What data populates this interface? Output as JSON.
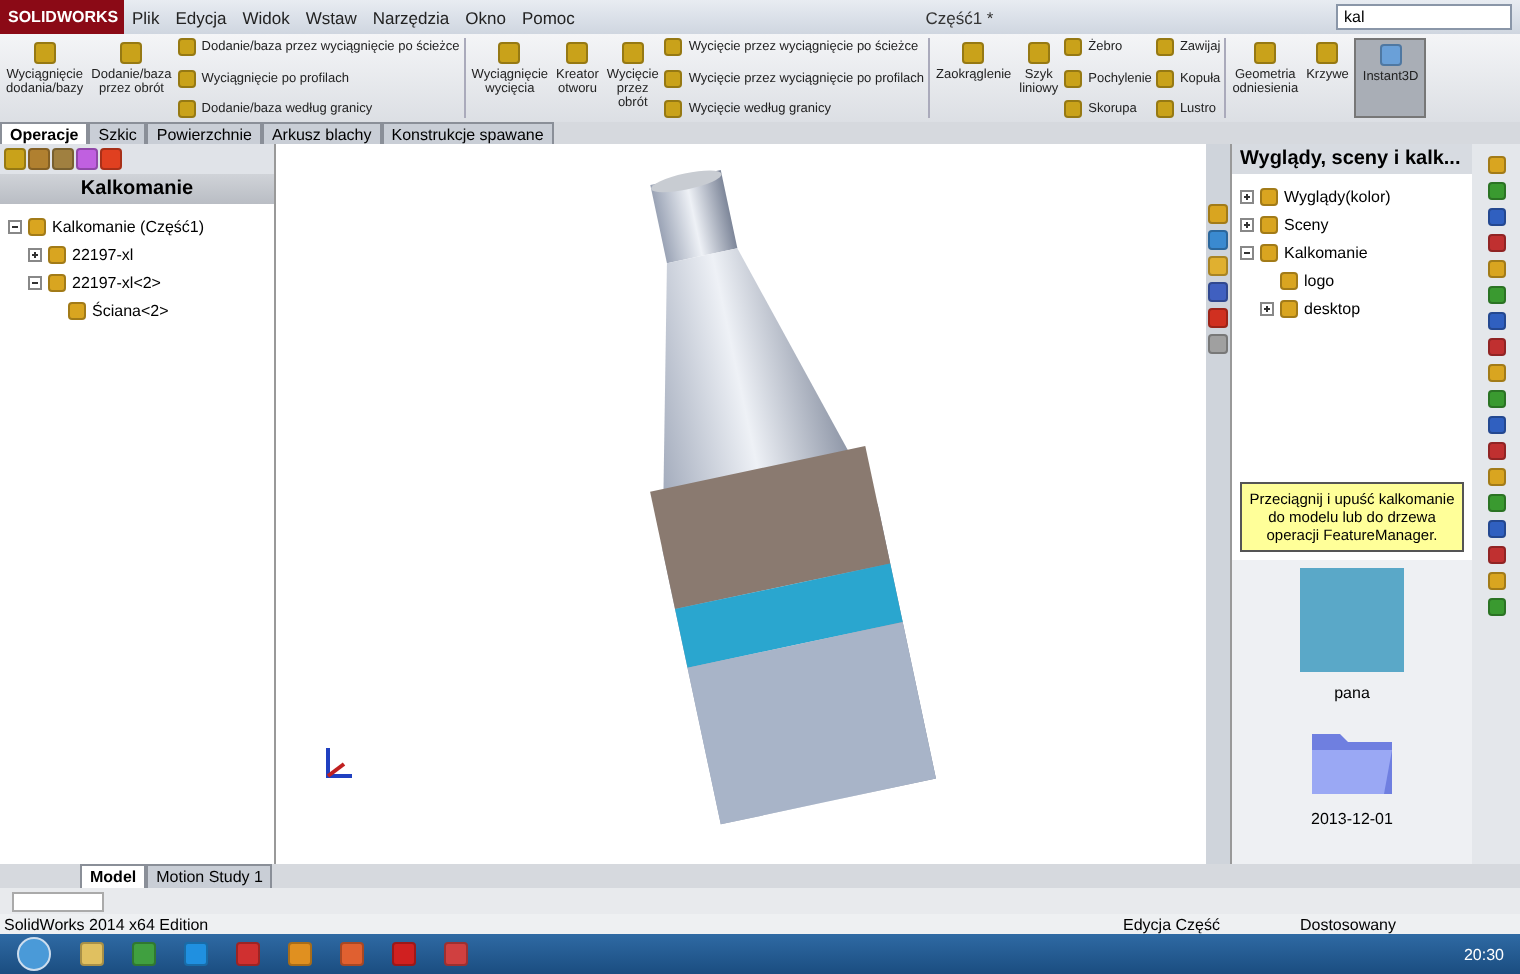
{
  "logo": "SOLIDWORKS",
  "menu": [
    "Plik",
    "Edycja",
    "Widok",
    "Wstaw",
    "Narzędzia",
    "Okno",
    "Pomoc"
  ],
  "title": "Część1 *",
  "search": {
    "value": "kal"
  },
  "ribbon": [
    {
      "kind": "large",
      "label": "Wyciągnięcie dodania/bazy"
    },
    {
      "kind": "large",
      "label": "Dodanie/baza przez obrót"
    },
    {
      "kind": "small",
      "items": [
        "Dodanie/baza przez wyciągnięcie po ścieżce",
        "Wyciągnięcie po profilach",
        "Dodanie/baza według granicy"
      ]
    },
    {
      "kind": "divider"
    },
    {
      "kind": "large",
      "label": "Wyciągnięcie wycięcia"
    },
    {
      "kind": "large",
      "label": "Kreator otworu"
    },
    {
      "kind": "large",
      "label": "Wycięcie przez obrót"
    },
    {
      "kind": "small",
      "items": [
        "Wycięcie przez wyciągnięcie po ścieżce",
        "Wycięcie przez wyciągnięcie po profilach",
        "Wycięcie według granicy"
      ]
    },
    {
      "kind": "divider"
    },
    {
      "kind": "large",
      "label": "Zaokrąglenie"
    },
    {
      "kind": "large",
      "label": "Szyk liniowy"
    },
    {
      "kind": "small",
      "items": [
        "Żebro",
        "Pochylenie",
        "Skorupa"
      ]
    },
    {
      "kind": "small",
      "items": [
        "Zawijaj",
        "Kopuła",
        "Lustro"
      ]
    },
    {
      "kind": "divider"
    },
    {
      "kind": "large",
      "label": "Geometria odniesienia"
    },
    {
      "kind": "large",
      "label": "Krzywe"
    },
    {
      "kind": "toggle",
      "label": "Instant3D",
      "on": true
    }
  ],
  "command_tabs": [
    {
      "label": "Operacje",
      "selected": true
    },
    {
      "label": "Szkic",
      "selected": false
    },
    {
      "label": "Powierzchnie",
      "selected": false
    },
    {
      "label": "Arkusz blachy",
      "selected": false
    },
    {
      "label": "Konstrukcje spawane",
      "selected": false
    }
  ],
  "left_panel": {
    "title": "Kalkomanie",
    "tree": [
      {
        "label": "Kalkomanie (Część1)",
        "expanded": true,
        "children": [
          {
            "label": "22197-xl",
            "expanded": false
          },
          {
            "label": "22197-xl<2>",
            "expanded": true,
            "children": [
              {
                "label": "Ściana<2>"
              }
            ]
          }
        ]
      }
    ]
  },
  "task_pane": {
    "title": "Wyglądy, sceny i kalk...",
    "tree": [
      {
        "label": "Wyglądy(kolor)",
        "expanded": false
      },
      {
        "label": "Sceny",
        "expanded": false
      },
      {
        "label": "Kalkomanie",
        "expanded": true,
        "children": [
          {
            "label": "logo"
          },
          {
            "label": "desktop",
            "expanded": false
          }
        ]
      }
    ],
    "tip": "Przeciągnij i upuść kalkomanie do modelu lub do drzewa operacji FeatureManager.",
    "thumbnails": [
      {
        "kind": "photo",
        "label": "pana"
      },
      {
        "kind": "folder",
        "label": "2013-12-01"
      }
    ]
  },
  "bottom_tabs": [
    {
      "label": "Model",
      "selected": true
    },
    {
      "label": "Motion Study 1",
      "selected": false
    }
  ],
  "status_bar": {
    "left": "SolidWorks 2014 x64 Edition",
    "mode": "Edycja Część",
    "units": "Dostosowany"
  },
  "clock": "20:30"
}
